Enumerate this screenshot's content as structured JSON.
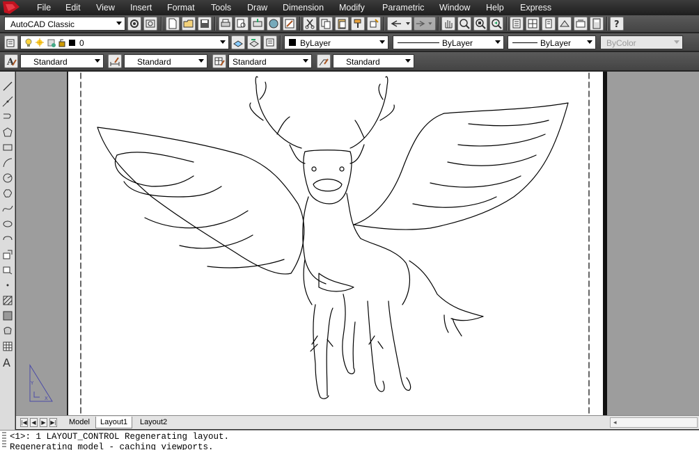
{
  "menubar": {
    "items": [
      "File",
      "Edit",
      "View",
      "Insert",
      "Format",
      "Tools",
      "Draw",
      "Dimension",
      "Modify",
      "Parametric",
      "Window",
      "Help",
      "Express"
    ]
  },
  "toolbar1": {
    "workspace": "AutoCAD Classic"
  },
  "toolbar2": {
    "layer": "0",
    "color": "ByLayer",
    "linetype": "ByLayer",
    "lineweight": "ByLayer",
    "plotstyle": "ByColor"
  },
  "toolbar3": {
    "text_style": "Standard",
    "dim_style": "Standard",
    "table_style": "Standard",
    "mleader_style": "Standard"
  },
  "tabs": {
    "model": "Model",
    "layout1": "Layout1",
    "layout2": "Layout2"
  },
  "command_line": {
    "line1": "<1>: 1 LAYOUT_CONTROL Regenerating layout.",
    "line2": "Regenerating model - caching viewports."
  },
  "colors": {
    "menubar_bg": "#2b2b2b",
    "toolbar_bg": "#4e4e4e",
    "workspace_bg": "#9d9d9d",
    "paper": "#ffffff",
    "ucs_icon": "#4a4aa8"
  }
}
